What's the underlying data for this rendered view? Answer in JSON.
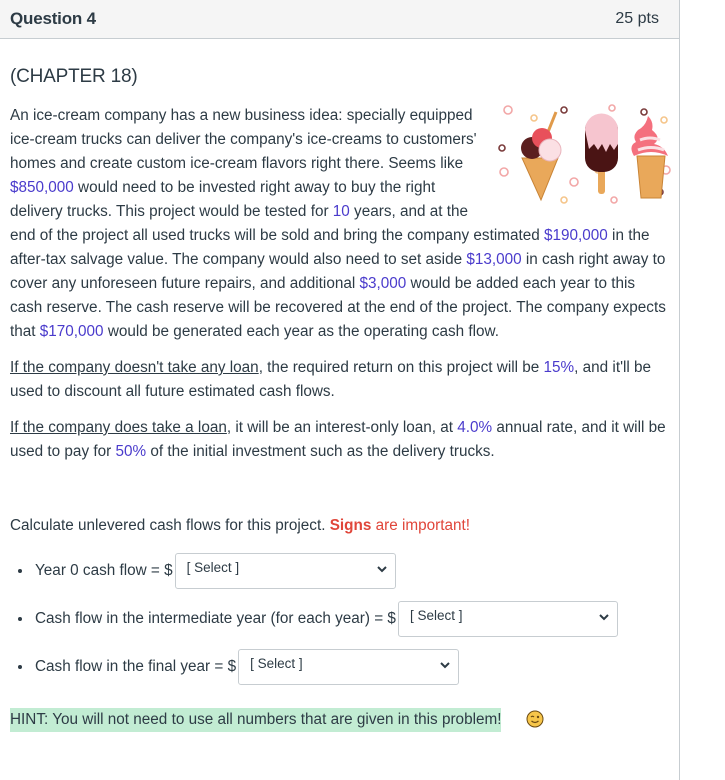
{
  "question": {
    "title": "Question 4",
    "points": "25 pts"
  },
  "chapter": "(CHAPTER 18)",
  "image": {
    "alt": "ice-cream illustration (cone, popsicle, soft-serve)"
  },
  "paragraph1": {
    "t1": "An ice-cream company has a new business idea: specially equipped ice-cream trucks can deliver the company's ice-creams to customers' homes and create custom ice-cream flavors right there. Seems like ",
    "v_investment": "$850,000",
    "t2": " would need to be invested right away to buy the right delivery trucks. This project would be tested for ",
    "v_years": "10",
    "t3": " years, and at the end of the project all used trucks will be sold and bring the company estimated ",
    "v_salvage": "$190,000",
    "t4": " in the after-tax salvage value. The company would also need to set aside ",
    "v_reserve": "$13,000",
    "t5": " in cash right away to cover any unforeseen future repairs, and additional ",
    "v_added": "$3,000",
    "t6": " would be added each year to this cash reserve. The cash reserve will be recovered at the end of the project. The company expects that ",
    "v_ocf": "$170,000",
    "t7": " would be generated each year as the operating cash flow."
  },
  "paragraph2": {
    "u": "If the company doesn't take any loan",
    "t1": ", the required return on this project will be ",
    "v_rate": "15%",
    "t2": ", and it'll be used to discount all future estimated cash flows."
  },
  "paragraph3": {
    "u": "If the company does take a loan",
    "t1": ", it will be an interest-only loan, at ",
    "v_rate": "4.0%",
    "t2": " annual rate, and it will be used to pay for ",
    "v_share": "50%",
    "t3": " of the initial investment such as the delivery trucks."
  },
  "instruction": {
    "text": "Calculate unlevered cash flows for this project. ",
    "signs": "Signs",
    "important": " are important!"
  },
  "answers": [
    {
      "label": "Year 0 cash flow = $",
      "selected": "[ Select ]"
    },
    {
      "label": "Cash flow in the intermediate year (for each year) = $",
      "selected": "[ Select ]"
    },
    {
      "label": "Cash flow in the final year = $",
      "selected": "[ Select ]"
    }
  ],
  "hint": "HINT: You will not need to use all numbers that are given in this problem!",
  "hint_emoji": "winking-face",
  "colors": {
    "value_highlight": "#4a3bcc",
    "warning_red": "#e0463a",
    "hint_background": "#c2ecd3",
    "header_background": "#f5f5f5"
  }
}
